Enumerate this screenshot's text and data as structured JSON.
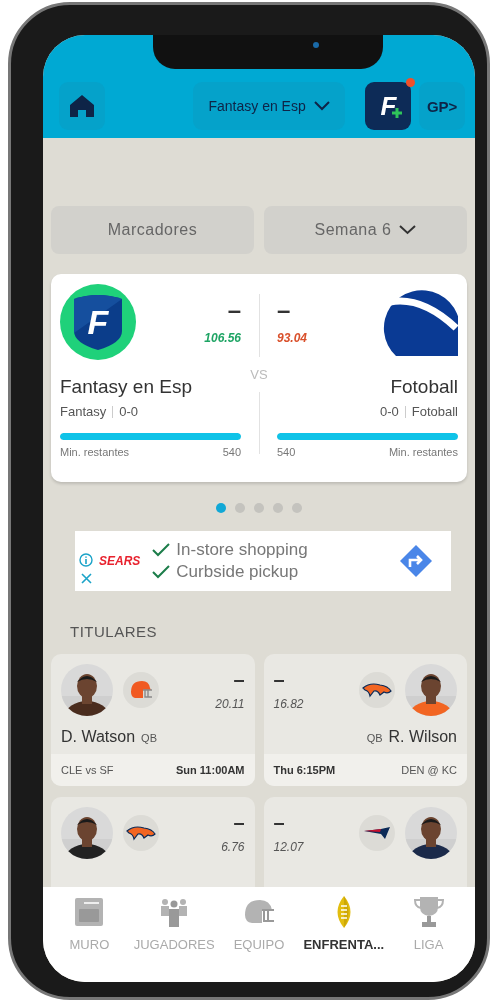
{
  "header": {
    "league": "Fantasy en Esp",
    "brand_mark": "F",
    "notification": true,
    "gp_label": "GP>"
  },
  "filters": [
    {
      "label": "Marcadores",
      "dropdown": false
    },
    {
      "label": "Semana 6",
      "dropdown": true
    }
  ],
  "matchup": {
    "vs": "VS",
    "teams": [
      {
        "kind": "shield",
        "logo_letter": "F",
        "score": "–",
        "projected": "106.56",
        "color": "#1ea464",
        "name": "Fantasy en Esp",
        "owner": "Fantasy",
        "record": "0-0",
        "level": 1,
        "minutes_label": "Min. restantes",
        "minutes": "540"
      },
      {
        "kind": "ball",
        "score": "–",
        "projected": "93.04",
        "color": "#d9502b",
        "name": "Fotoball",
        "owner": "Fotoball",
        "record": "0-0",
        "level": 1,
        "minutes_label": "Min. restantes",
        "minutes": "540"
      }
    ]
  },
  "pager": [
    {
      "selected": true
    },
    {
      "selected": false
    },
    {
      "selected": false
    },
    {
      "selected": false
    },
    {
      "selected": false
    }
  ],
  "ad": {
    "brand": "SEARS",
    "lines": [
      "In-store shopping",
      "Curbside pickup"
    ]
  },
  "section_title": "TITULARES",
  "starters": [
    {
      "kind": "helmet",
      "score": "–",
      "projected": "20.11",
      "name": "D. Watson",
      "position": "QB",
      "matchup": "CLE vs SF",
      "kickoff": "Sun 11:00AM"
    },
    {
      "kind": "horse",
      "score": "–",
      "projected": "16.82",
      "name": "R. Wilson",
      "position": "QB",
      "matchup": "DEN @ KC",
      "kickoff": "Thu 6:15PM"
    },
    {
      "kind": "horse",
      "score": "–",
      "projected": "6.76"
    },
    {
      "kind": "swoosh",
      "score": "–",
      "projected": "12.07"
    }
  ],
  "tabs": [
    {
      "label": "MURO",
      "selected": false
    },
    {
      "label": "JUGADORES",
      "selected": false
    },
    {
      "label": "EQUIPO",
      "selected": false
    },
    {
      "label": "ENFRENTA...",
      "selected": true
    },
    {
      "label": "LIGA",
      "selected": false
    }
  ]
}
